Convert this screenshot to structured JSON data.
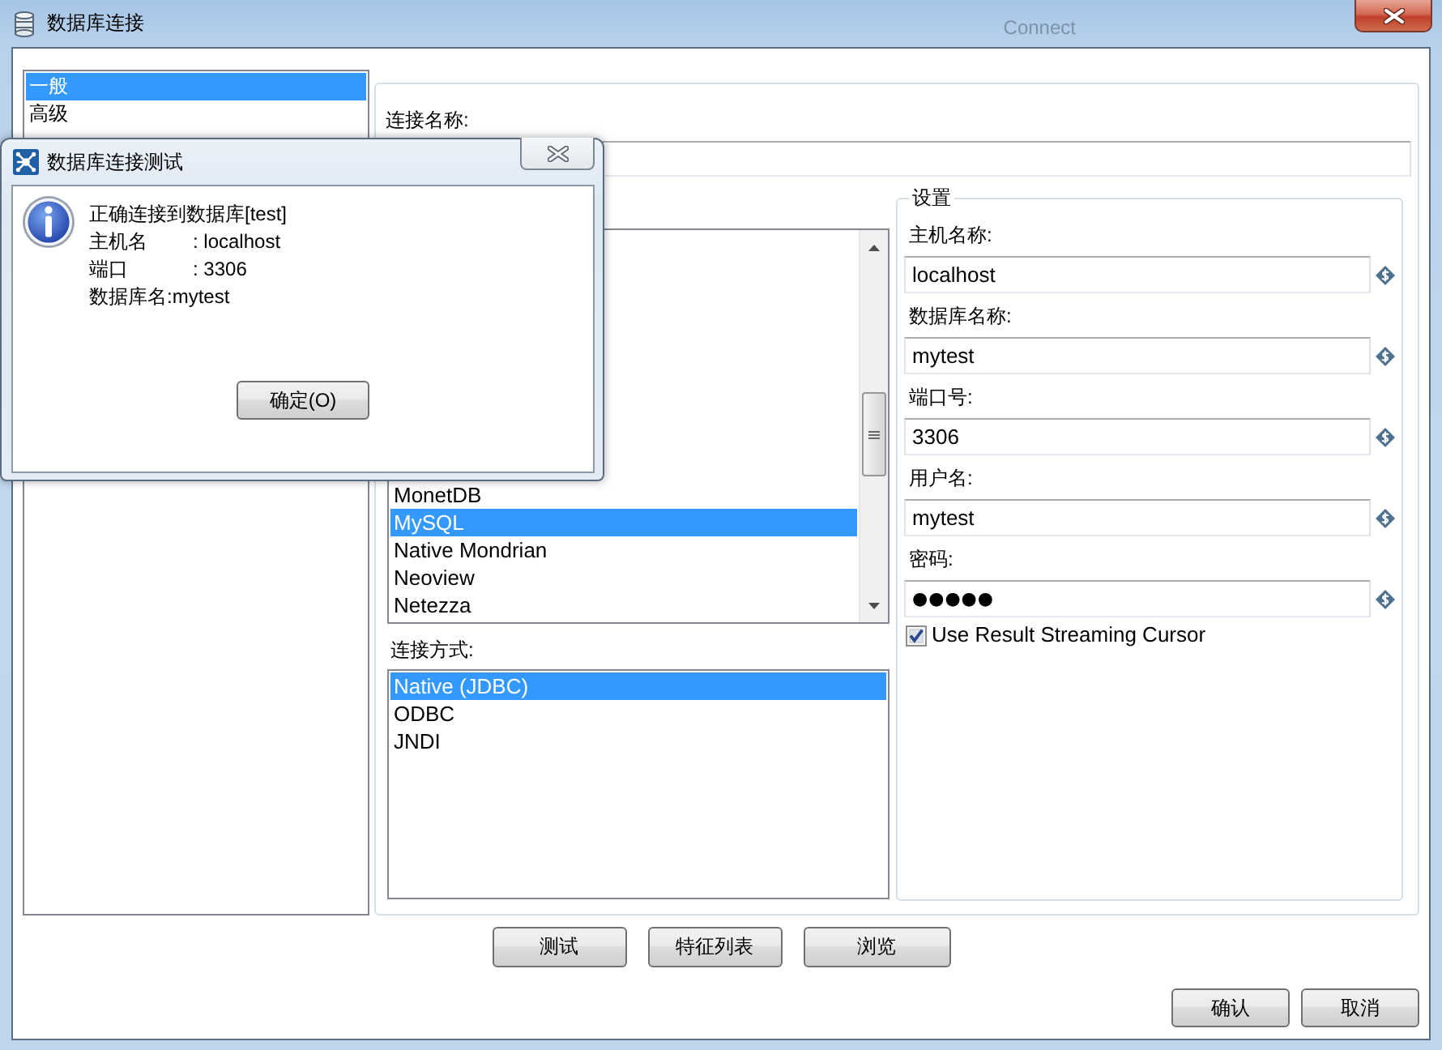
{
  "window": {
    "title": "数据库连接",
    "background_text": "Connect"
  },
  "sidebar": {
    "items": [
      {
        "label": "一般",
        "selected": true
      },
      {
        "label": "高级",
        "selected": false
      }
    ]
  },
  "general": {
    "connection_name_label": "连接名称:",
    "database_types": {
      "items": [
        {
          "label": "MonetDB",
          "selected": false
        },
        {
          "label": "MySQL",
          "selected": true
        },
        {
          "label": "Native Mondrian",
          "selected": false
        },
        {
          "label": "Neoview",
          "selected": false
        },
        {
          "label": "Netezza",
          "selected": false
        }
      ]
    },
    "access": {
      "label": "连接方式:",
      "items": [
        {
          "label": "Native (JDBC)",
          "selected": true
        },
        {
          "label": "ODBC",
          "selected": false
        },
        {
          "label": "JNDI",
          "selected": false
        }
      ]
    },
    "settings": {
      "title": "设置",
      "fields": [
        {
          "label": "主机名称:",
          "value": "localhost",
          "kind": "text"
        },
        {
          "label": "数据库名称:",
          "value": "mytest",
          "kind": "text"
        },
        {
          "label": "端口号:",
          "value": "3306",
          "kind": "text"
        },
        {
          "label": "用户名:",
          "value": "mytest",
          "kind": "text"
        },
        {
          "label": "密码:",
          "value": "●●●●●",
          "kind": "password"
        }
      ],
      "streaming_cursor": {
        "label": "Use Result Streaming Cursor",
        "checked": true
      }
    }
  },
  "action_buttons": [
    "测试",
    "特征列表",
    "浏览"
  ],
  "dialog_buttons": [
    "确认",
    "取消"
  ],
  "test_dialog": {
    "title": "数据库连接测试",
    "message_lines": [
      "正确连接到数据库[test]",
      "主机名\t: localhost",
      "端口\t: 3306",
      "数据库名:mytest"
    ],
    "button": "确定(O)"
  }
}
